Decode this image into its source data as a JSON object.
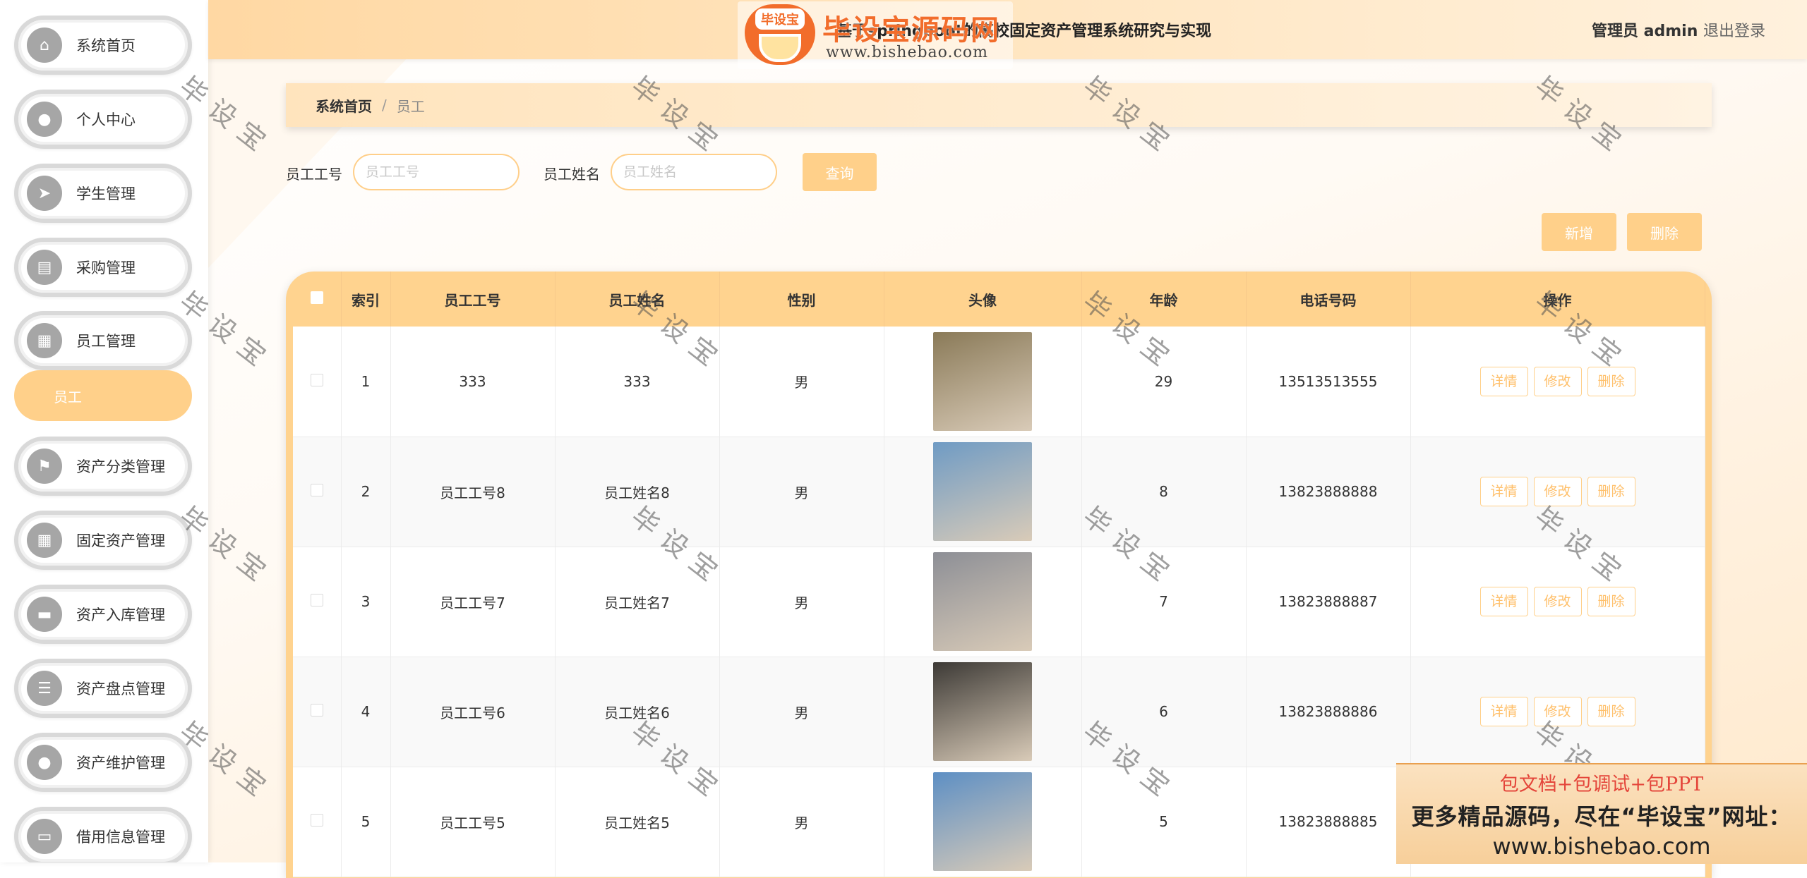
{
  "sidebar": {
    "items": [
      {
        "label": "系统首页",
        "icon": "home-icon"
      },
      {
        "label": "个人中心",
        "icon": "user-icon"
      },
      {
        "label": "学生管理",
        "icon": "send-icon"
      },
      {
        "label": "采购管理",
        "icon": "clipboard-icon"
      },
      {
        "label": "员工管理",
        "icon": "grid-icon"
      },
      {
        "label": "资产分类管理",
        "icon": "flag-icon"
      },
      {
        "label": "固定资产管理",
        "icon": "grid-icon"
      },
      {
        "label": "资产入库管理",
        "icon": "chat-icon"
      },
      {
        "label": "资产盘点管理",
        "icon": "list-icon"
      },
      {
        "label": "资产维护管理",
        "icon": "user-icon"
      },
      {
        "label": "借用信息管理",
        "icon": "ticket-icon"
      }
    ],
    "submenu": {
      "label": "员工"
    }
  },
  "header": {
    "logo_badge": "毕设宝",
    "logo_brand": "毕设宝源码网",
    "logo_url": "www.bishebao.com",
    "title": "基于springboot的高校固定资产管理系统研究与实现",
    "admin": "管理员 admin",
    "logout": "退出登录"
  },
  "breadcrumb": {
    "home": "系统首页",
    "separator": "/",
    "current": "员工"
  },
  "search": {
    "emp_no_label": "员工工号",
    "emp_no_placeholder": "员工工号",
    "emp_name_label": "员工姓名",
    "emp_name_placeholder": "员工姓名",
    "query_button": "查询"
  },
  "actions": {
    "add": "新增",
    "delete": "删除"
  },
  "table": {
    "columns": [
      "索引",
      "员工工号",
      "员工姓名",
      "性别",
      "头像",
      "年龄",
      "电话号码",
      "操作"
    ],
    "ops": [
      "详情",
      "修改",
      "删除"
    ],
    "rows": [
      {
        "index": "1",
        "emp_no": "333",
        "name": "333",
        "gender": "男",
        "age": "29",
        "phone": "13513513555",
        "avatar_color": "#8a7a58"
      },
      {
        "index": "2",
        "emp_no": "员工工号8",
        "name": "员工姓名8",
        "gender": "男",
        "age": "8",
        "phone": "13823888888",
        "avatar_color": "#6f9bc4"
      },
      {
        "index": "3",
        "emp_no": "员工工号7",
        "name": "员工姓名7",
        "gender": "男",
        "age": "7",
        "phone": "13823888887",
        "avatar_color": "#8d8f96"
      },
      {
        "index": "4",
        "emp_no": "员工工号6",
        "name": "员工姓名6",
        "gender": "男",
        "age": "6",
        "phone": "13823888886",
        "avatar_color": "#3d3a36"
      },
      {
        "index": "5",
        "emp_no": "员工工号5",
        "name": "员工姓名5",
        "gender": "男",
        "age": "5",
        "phone": "13823888885",
        "avatar_color": "#5d8fc4"
      }
    ]
  },
  "watermark": "毕设宝",
  "ad": {
    "line1": "包文档+包调试+包PPT",
    "line2": "更多精品源码，尽在“毕设宝”网址：",
    "line3": "www.bishebao.com"
  }
}
